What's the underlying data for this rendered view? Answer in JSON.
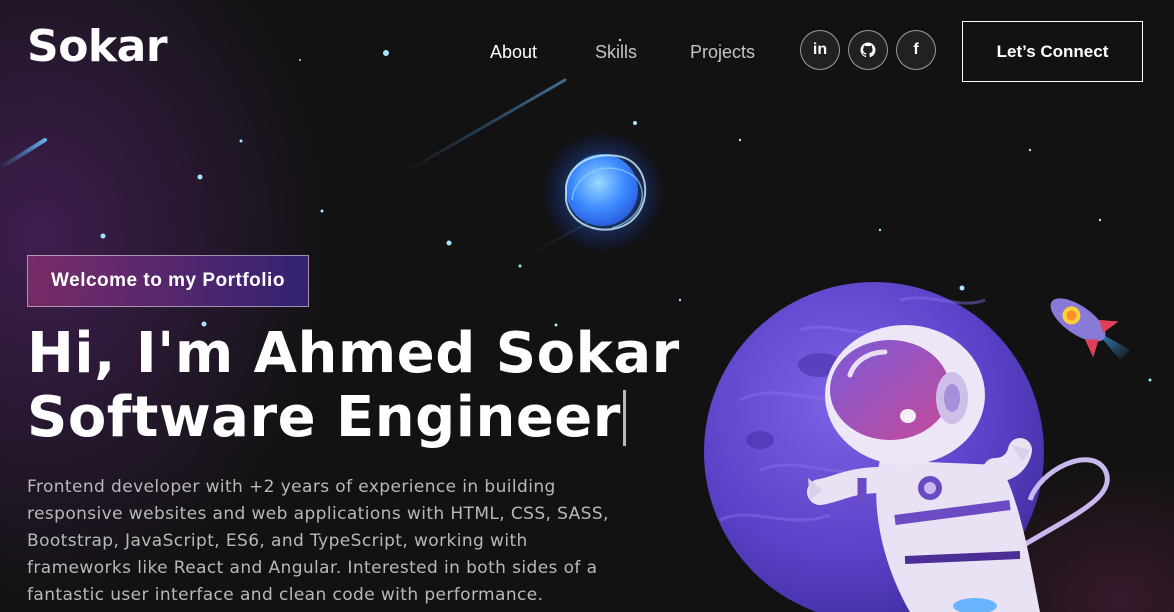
{
  "brand": {
    "logo": "Sokar"
  },
  "nav": {
    "links": [
      "About",
      "Skills",
      "Projects"
    ],
    "social": [
      {
        "name": "linkedin",
        "glyph": "in"
      },
      {
        "name": "github",
        "glyph": "github-icon"
      },
      {
        "name": "facebook",
        "glyph": "f"
      }
    ],
    "cta_label": "Let’s Connect"
  },
  "hero": {
    "tagline": "Welcome to my Portfolio",
    "title_line1": "Hi, I'm Ahmed Sokar",
    "title_line2": "Software Engineer",
    "description": "Frontend developer with +2 years of experience in building responsive websites and web applications with HTML, CSS, SASS, Bootstrap, JavaScript, ES6, and TypeScript, working with frameworks like React and Angular. Interested in both sides of a fantastic user interface and clean code with performance."
  },
  "theme": {
    "background": "#121212",
    "accent_pink": "#AA367C",
    "accent_purple": "#4A2FBD",
    "planet": "#6A4BD0"
  }
}
